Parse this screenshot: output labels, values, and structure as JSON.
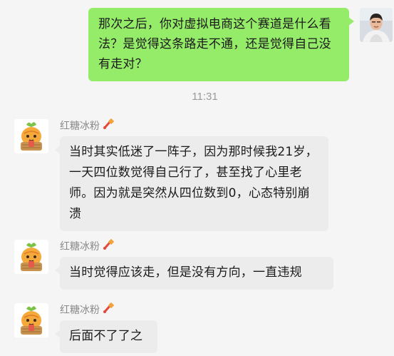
{
  "conversation": {
    "outgoing": {
      "text": "那次之后，你对虚拟电商这个赛道是什么看法？是觉得这条路走不通，还是觉得自己没有走对？",
      "avatar_icon": "user-photo-avatar"
    },
    "timestamp": "11:31",
    "incoming": [
      {
        "sender": "红糖冰粉",
        "sender_tag_icon": "brush-tag-icon",
        "avatar_icon": "carrot-cartoon-avatar",
        "text": "当时其实低迷了一阵子，因为那时候我21岁，一天四位数觉得自己行了，甚至找了心里老师。因为就是突然从四位数到0，心态特别崩溃"
      },
      {
        "sender": "红糖冰粉",
        "sender_tag_icon": "brush-tag-icon",
        "avatar_icon": "carrot-cartoon-avatar",
        "text": "当时觉得应该走，但是没有方向，一直违规"
      },
      {
        "sender": "红糖冰粉",
        "sender_tag_icon": "brush-tag-icon",
        "avatar_icon": "carrot-cartoon-avatar",
        "text": "后面不了了之"
      }
    ]
  },
  "colors": {
    "outgoing_bubble": "#95ec69",
    "incoming_bubble": "#ececec",
    "background": "#f5f5f5",
    "timestamp": "#9a9a9a",
    "sender_name": "#8a8a8a"
  }
}
